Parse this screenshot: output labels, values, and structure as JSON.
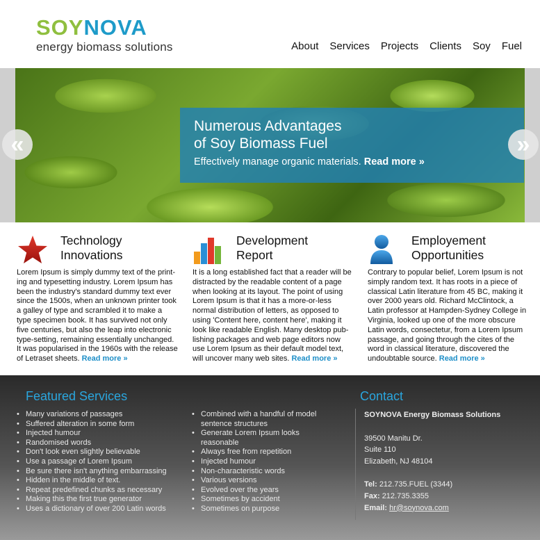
{
  "brand": {
    "name_part1": "SOY",
    "name_part2": "NOVA",
    "tagline": "energy biomass solutions",
    "colors": {
      "green": "#8fbf3f",
      "blue": "#1e9bc9"
    }
  },
  "nav": {
    "items": [
      "About",
      "Services",
      "Projects",
      "Clients",
      "Soy",
      "Fuel"
    ]
  },
  "hero": {
    "title_line1": "Numerous Advantages",
    "title_line2": "of Soy Biomass Fuel",
    "subtitle": "Effectively manage organic materials.",
    "read_more": "Read more »",
    "prev_label": "«",
    "next_label": "»"
  },
  "features": [
    {
      "icon": "star-icon",
      "title_line1": "Technology",
      "title_line2": "Innovations",
      "text": "Lorem Ipsum is simply dummy text of the print-ing and typesetting industry. Lorem Ipsum has been the industry's standard dummy text ever since the 1500s, when an unknown printer took a galley of type and scrambled it to make a type specimen book. It has survived not only five centuries, but also the leap into electronic type-setting, remaining essentially unchanged. It was popularised in the 1960s with the release of Letraset sheets.",
      "read_more": "Read more »"
    },
    {
      "icon": "bar-chart-icon",
      "title_line1": "Development",
      "title_line2": "Report",
      "text": "It is a long established fact that a reader will be distracted by the readable content of a page when looking at its layout. The point of using Lorem Ipsum is that it has a more-or-less normal distribution of letters, as opposed to using 'Content here, content here', making it look like readable English. Many desktop pub-lishing packages and web page editors now use Lorem Ipsum as their default model text, will uncover many web sites.",
      "read_more": "Read more »"
    },
    {
      "icon": "person-icon",
      "title_line1": "Employement",
      "title_line2": "Opportunities",
      "text": "Contrary to popular belief, Lorem Ipsum is not simply random text. It has roots in a piece of classical Latin literature from 45 BC, making it over 2000 years old. Richard McClintock, a Latin professor at Hampden-Sydney College in Virginia, looked up one of the more obscure Latin words, consectetur, from a Lorem Ipsum passage, and going through the cites of the word in classical literature, discovered the undoubtable source.",
      "read_more": "Read more »"
    }
  ],
  "footer": {
    "services_title": "Featured Services",
    "services_col1": [
      "Many variations of passages",
      "Suffered alteration in some form",
      "Injected humour",
      "Randomised words",
      "Don't look even slightly believable",
      "Use a passage of Lorem Ipsum",
      "Be sure there isn't anything embarrassing",
      "Hidden in the middle of text.",
      "Repeat predefined chunks as necessary",
      "Making this the first true generator",
      "Uses a dictionary of over 200 Latin words"
    ],
    "services_col2": [
      "Combined with a handful of model sentence structures",
      "Generate Lorem Ipsum looks reasonable",
      "Always free from repetition",
      "Injected humour",
      "Non-characteristic words",
      "Various versions",
      "Evolved over the years",
      "Sometimes by accident",
      "Sometimes on purpose"
    ],
    "contact_title": "Contact",
    "contact": {
      "company": "SOYNOVA Energy Biomass Solutions",
      "address_line1": "39500 Manitu Dr.",
      "address_line2": "Suite 110",
      "address_line3": "Elizabeth, NJ 48104",
      "tel_label": "Tel:",
      "tel": "212.735.FUEL (3344)",
      "fax_label": "Fax:",
      "fax": "212.735.3355",
      "email_label": "Email:",
      "email": "hr@soynova.com"
    }
  }
}
